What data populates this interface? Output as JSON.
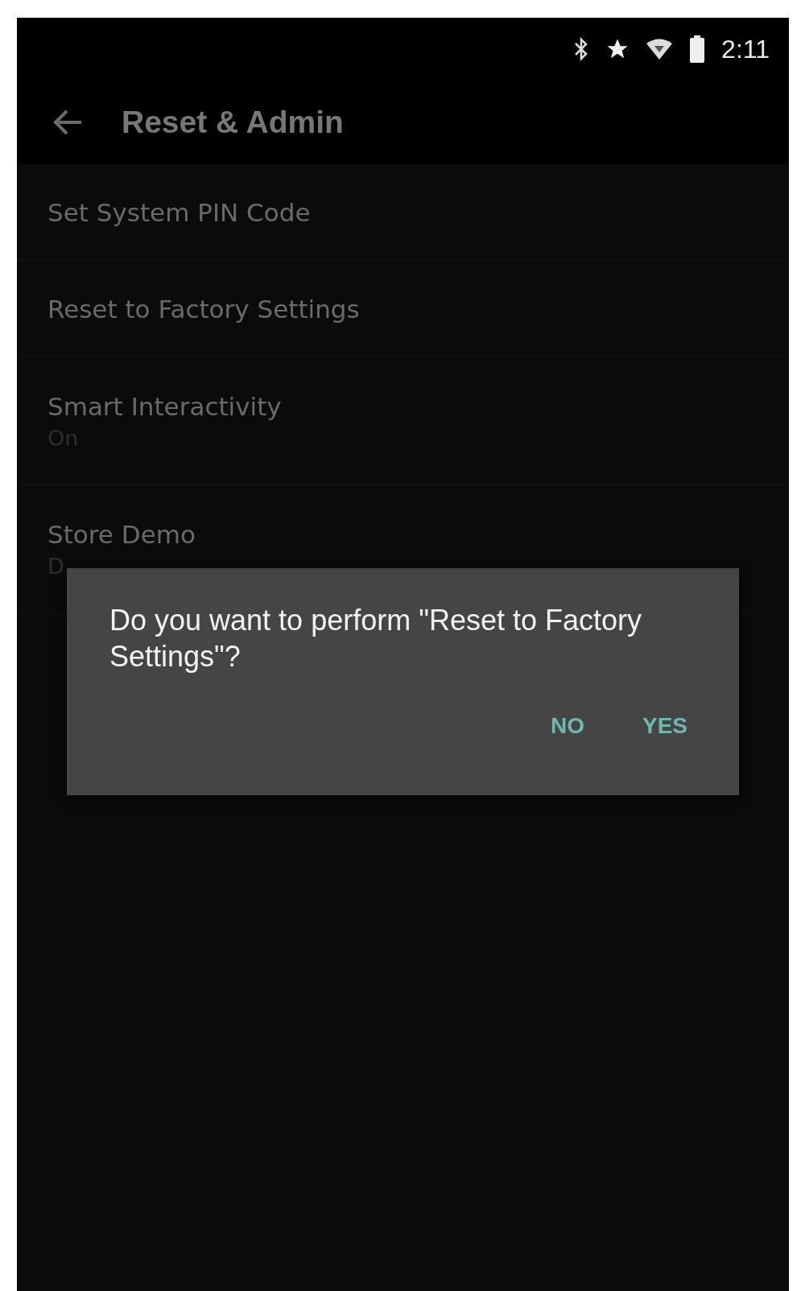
{
  "status_bar": {
    "time": "2:11"
  },
  "header": {
    "title": "Reset & Admin"
  },
  "items": [
    {
      "title": "Set System PIN Code"
    },
    {
      "title": "Reset to Factory Settings"
    },
    {
      "title": "Smart Interactivity",
      "subtitle": "On"
    },
    {
      "title": "Store Demo",
      "subtitle": "D"
    }
  ],
  "dialog": {
    "message": "Do you want to perform \"Reset to Factory Settings\"?",
    "buttons": [
      "NO",
      "YES"
    ]
  }
}
